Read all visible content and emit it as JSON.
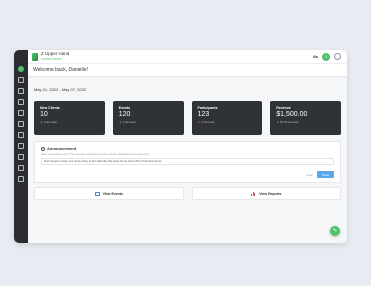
{
  "brand": {
    "name": "Z Upper Hand",
    "sub": "SUPER ADMIN"
  },
  "topbar": {
    "env_label": "lllu",
    "avatar_letter": "J"
  },
  "welcome": "Welcome back, Danielle!",
  "date_range": "May 01, 2022 - May 07, 2022",
  "stats": [
    {
      "title": "New Clients",
      "value": "10",
      "sub": "0 last week",
      "trend": "up"
    },
    {
      "title": "Events",
      "value": "120",
      "sub": "0 last week",
      "trend": "up"
    },
    {
      "title": "Participants",
      "value": "123",
      "sub": "0 last week",
      "trend": "down"
    },
    {
      "title": "Revenue",
      "value": "$1,500.00",
      "sub": "$0.00 last week",
      "trend": "up"
    }
  ],
  "announcement": {
    "title": "Announcement",
    "help": "Have something to say? This message will appear on your clients' dashboard when they log in.",
    "input_value": "Don't forget to wear your team jersey to this Saturday this week for an extra 10% off all shop items!",
    "clear_label": "Clear",
    "save_label": "Save"
  },
  "links": {
    "events_label": "View Events",
    "reports_label": "View Reports"
  },
  "colors": {
    "accent": "#4fc26c",
    "card_bg": "#2f3237",
    "sidebar_bg": "#2b2d33",
    "save_button": "#5aa8e8"
  }
}
